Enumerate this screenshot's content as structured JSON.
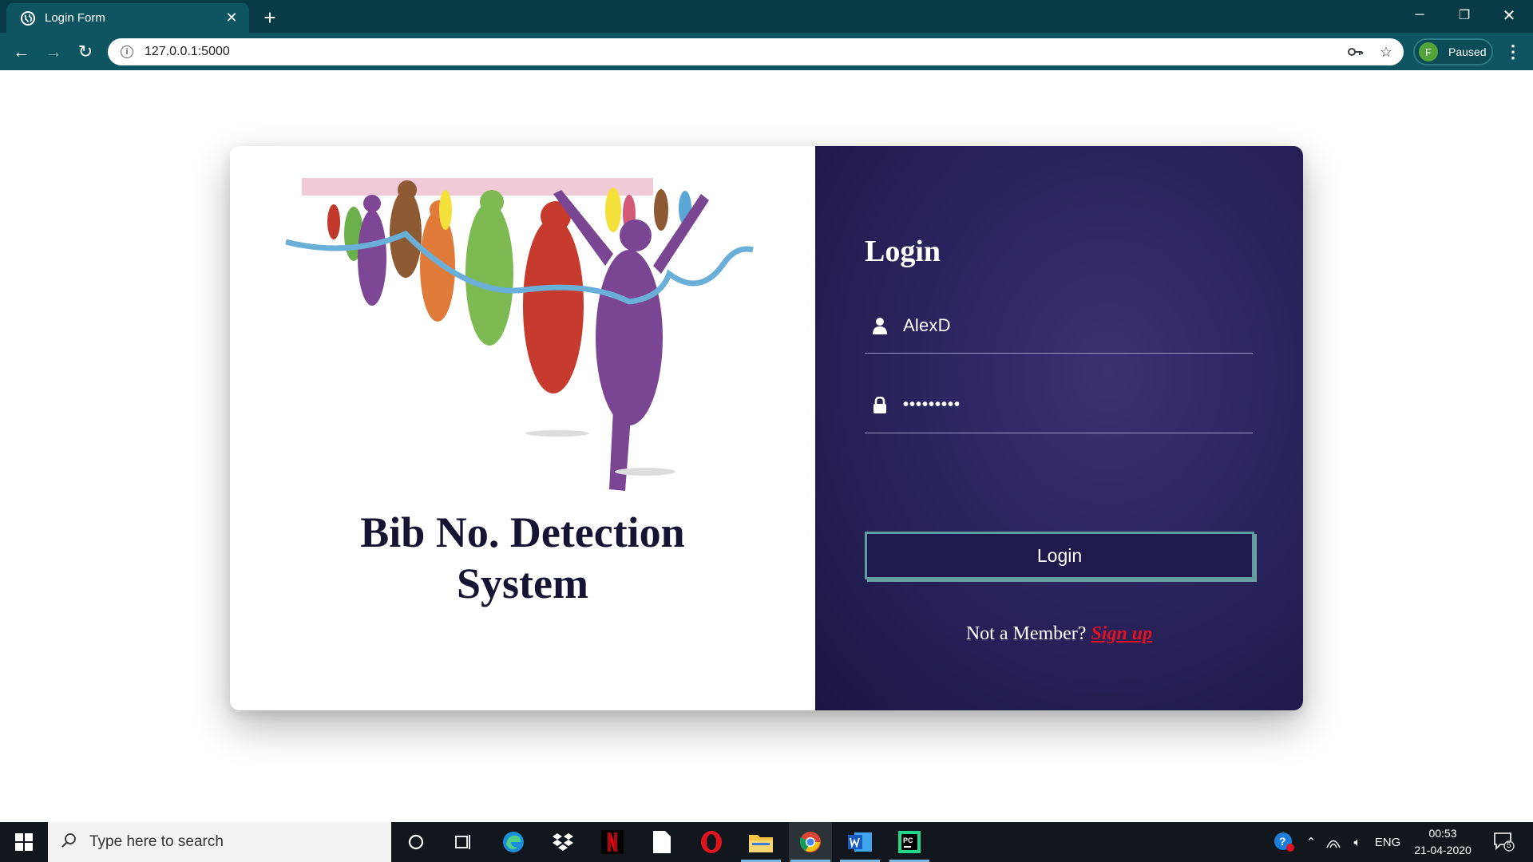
{
  "browser": {
    "tab_title": "Login Form",
    "url": "127.0.0.1:5000",
    "profile_initial": "F",
    "profile_status": "Paused"
  },
  "left_panel": {
    "system_title_line1": "Bib No. Detection",
    "system_title_line2": "System",
    "illustration": "runners-crossing-finish-line"
  },
  "login": {
    "heading": "Login",
    "username_value": "AlexD",
    "password_value": "•••••••••",
    "button_label": "Login",
    "signup_prompt": "Not a Member?",
    "signup_link": "Sign up"
  },
  "taskbar": {
    "search_placeholder": "Type here to search",
    "language": "ENG",
    "time": "00:53",
    "date": "21-04-2020",
    "notification_count": "5",
    "apps": [
      "cortana",
      "task-view",
      "edge",
      "dropbox",
      "netflix",
      "notepad",
      "opera",
      "file-explorer",
      "chrome",
      "word",
      "pycharm"
    ]
  },
  "colors": {
    "tab_bar": "#083b45",
    "toolbar": "#0f5561",
    "login_panel": "#2c2661",
    "title_text": "#161433",
    "signup_link": "#e3101f",
    "button_border": "#5e9da0"
  }
}
